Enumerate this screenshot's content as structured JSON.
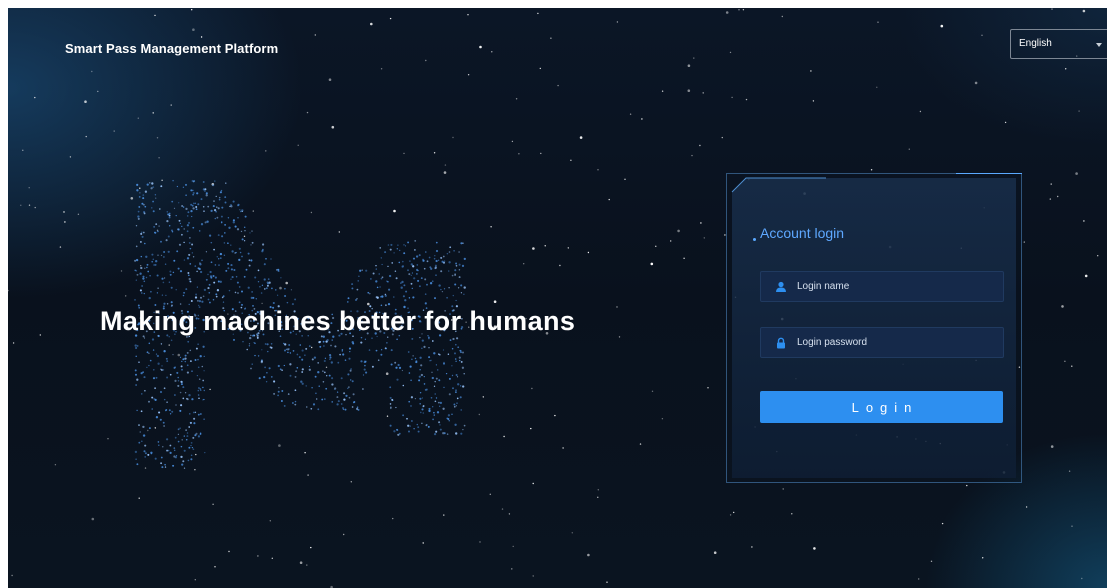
{
  "header": {
    "brand": "Smart Pass Management Platform",
    "language": "English",
    "language_icon": "caret-down-icon"
  },
  "hero": {
    "slogan": "Making machines better for humans"
  },
  "login": {
    "title": "Account login",
    "username_placeholder": "Login name",
    "username_icon": "user-icon",
    "password_placeholder": "Login password",
    "password_icon": "lock-icon",
    "submit_label": "Login"
  },
  "colors": {
    "background": "#09111d",
    "accent": "#2d8ff0",
    "title": "#5ea8ff",
    "field_bg": "#15294a"
  }
}
